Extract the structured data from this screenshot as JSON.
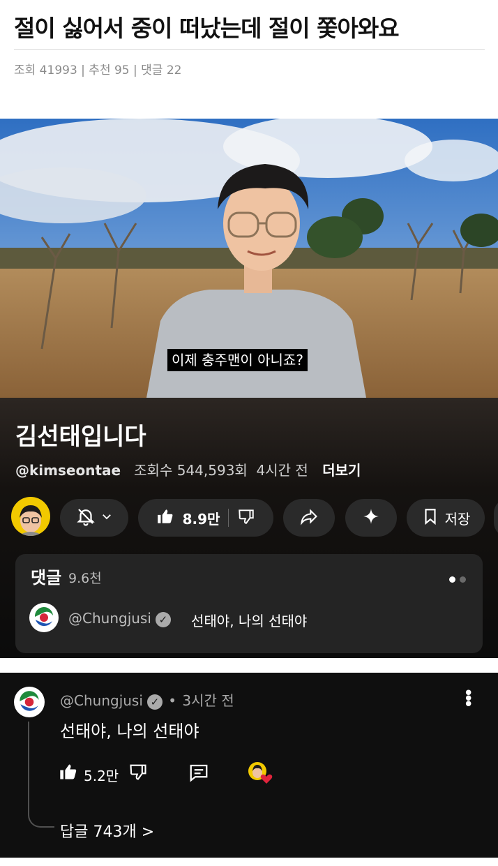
{
  "post": {
    "title": "절이 싫어서 중이 떠났는데 절이 쫓아와요",
    "meta": "조회 41993 | 추천 95 | 댓글 22"
  },
  "video": {
    "subtitle": "이제 충주맨이 아니죠?",
    "channel_title": "김선태입니다",
    "handle": "@kimseontae",
    "views": "조회수 544,593회",
    "age": "4시간 전",
    "more": "더보기",
    "likes": "8.9만",
    "save_label": "저장"
  },
  "comments_preview": {
    "title": "댓글",
    "count": "9.6천",
    "user": "@Chungjusi",
    "text": "선태야, 나의 선태야"
  },
  "comment": {
    "user": "@Chungjusi",
    "age": "3시간 전",
    "text": "선태야, 나의 선태야",
    "likes": "5.2만",
    "replies": "답글 743개 >"
  },
  "colors": {
    "dark_bg": "#0f0f0f",
    "pill_bg": "#2a2a2a",
    "heart": "#e0243c",
    "avatar_yellow": "#f2c900"
  }
}
